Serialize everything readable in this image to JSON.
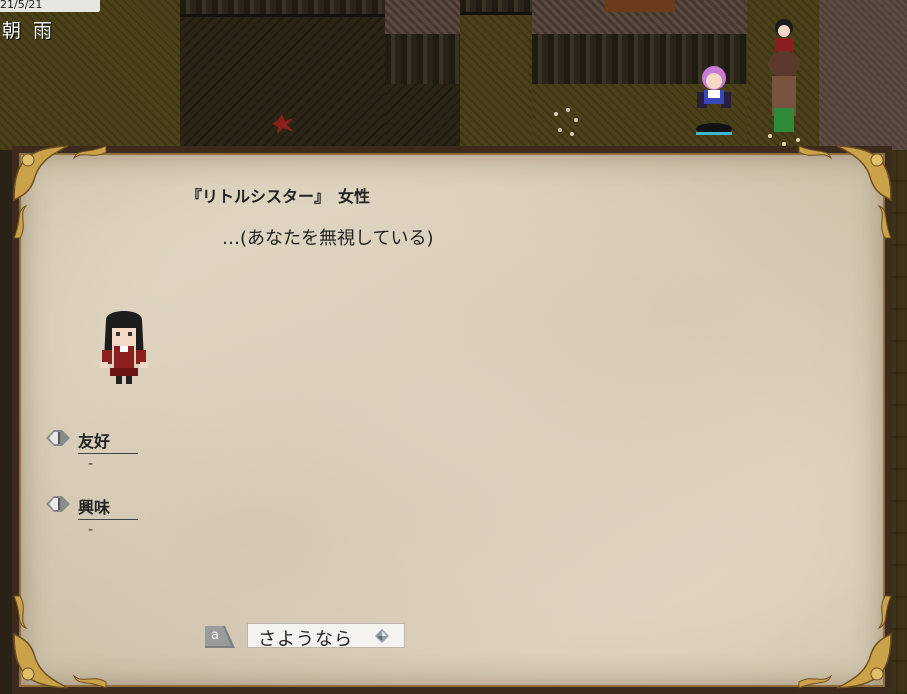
{
  "hud": {
    "date": "21/5/21",
    "time_weather": "朝 雨"
  },
  "dialog": {
    "speaker": "『リトルシスター』　女性",
    "message": "…(あなたを無視している)"
  },
  "stats": [
    {
      "label": "友好",
      "value": "-"
    },
    {
      "label": "興味",
      "value": "-"
    }
  ],
  "choices": [
    {
      "key": "a",
      "label": "さようなら",
      "icon": "diamond-cursor-icon"
    }
  ],
  "colors": {
    "panel_paper": "#e6dece",
    "panel_frame": "#3c2b1c",
    "gold_ornament": "#c9a24a"
  }
}
